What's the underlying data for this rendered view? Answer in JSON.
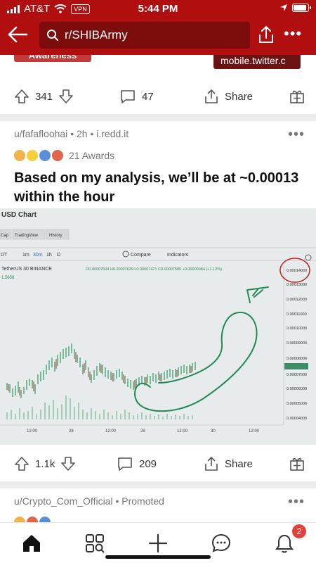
{
  "status_bar": {
    "carrier": "AT&T",
    "vpn": "VPN",
    "time": "5:44 PM"
  },
  "search": {
    "text": "r/SHIBArmy"
  },
  "prev_post": {
    "awareness": "Awareness",
    "link_domain": "mobile.twitter.c",
    "upvotes": "341",
    "comments": "47",
    "share": "Share"
  },
  "post": {
    "author": "u/fafafloohai",
    "sep1": "•",
    "age": "2h",
    "sep2": "•",
    "domain": "i.redd.it",
    "awards_count": "21 Awards",
    "title": "Based on my analysis, we’ll be at ~0.00013 within the hour",
    "upvotes": "1.1k",
    "comments": "209",
    "share": "Share"
  },
  "chart_image": {
    "title": "USD Chart",
    "tabs": [
      "Cap",
      "TradingView",
      "History"
    ],
    "toolbar": [
      "DT",
      "1m",
      "30m",
      "1h",
      "D",
      "Compare",
      "Indicators"
    ],
    "symbol": "TetherUS  30  BINANCE",
    "ohlc": "O0.00007504  H0.00007639  L0.00007471  C0.00007589  +0.00000084 (+1.12%)",
    "sub": "1.5658",
    "price_labels": [
      "0.00014000",
      "0.00013000",
      "0.00012000",
      "0.00011000",
      "0.00010000",
      "0.00009000",
      "0.00008000",
      "0.00007589",
      "0.00007000",
      "0.00006000",
      "0.00005000",
      "0.00004000"
    ],
    "time_labels": [
      "12:00",
      "28",
      "12:00",
      "29",
      "12:00",
      "30",
      "12:00"
    ]
  },
  "next_post": {
    "author": "u/Crypto_Com_Official",
    "sep": "•",
    "tag": "Promoted"
  },
  "colors": {
    "brand": "#b10f0f",
    "search_bg": "#7c0b0b",
    "marker": "#1f8a57",
    "circle": "#c02020",
    "badge": "#e0413a"
  },
  "tabbar": {
    "notifications_badge": "2"
  }
}
